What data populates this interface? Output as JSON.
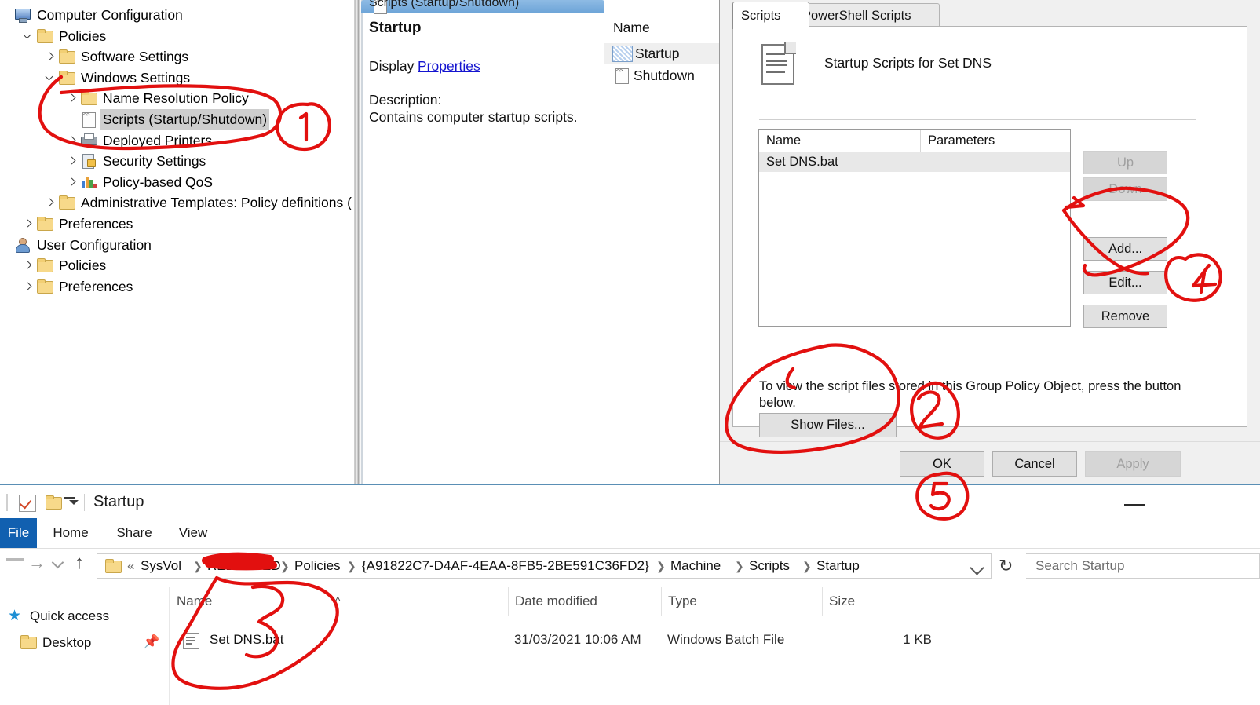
{
  "gpmc": {
    "tree": {
      "nodes": [
        {
          "label": "Computer Configuration",
          "icon": "computer-icon",
          "indent": 0,
          "chevron": "none",
          "selected": false
        },
        {
          "label": "Policies",
          "icon": "folder-icon",
          "indent": 1,
          "chevron": "down",
          "selected": false
        },
        {
          "label": "Software Settings",
          "icon": "folder-icon",
          "indent": 2,
          "chevron": "right",
          "selected": false
        },
        {
          "label": "Windows Settings",
          "icon": "folder-icon",
          "indent": 2,
          "chevron": "down",
          "selected": false
        },
        {
          "label": "Name Resolution Policy",
          "icon": "folder-icon",
          "indent": 3,
          "chevron": "right",
          "selected": false
        },
        {
          "label": "Scripts (Startup/Shutdown)",
          "icon": "script-icon",
          "indent": 3,
          "chevron": "none",
          "selected": true
        },
        {
          "label": "Deployed Printers",
          "icon": "printer-icon",
          "indent": 3,
          "chevron": "right",
          "selected": false
        },
        {
          "label": "Security Settings",
          "icon": "security-icon",
          "indent": 3,
          "chevron": "right",
          "selected": false
        },
        {
          "label": "Policy-based QoS",
          "icon": "qos-icon",
          "indent": 3,
          "chevron": "right",
          "selected": false
        },
        {
          "label": "Administrative Templates: Policy definitions (AD",
          "icon": "folder-icon",
          "indent": 2,
          "chevron": "right",
          "selected": false
        },
        {
          "label": "Preferences",
          "icon": "folder-icon",
          "indent": 1,
          "chevron": "right",
          "selected": false
        },
        {
          "label": "User Configuration",
          "icon": "user-icon",
          "indent": 0,
          "chevron": "none",
          "selected": false
        },
        {
          "label": "Policies",
          "icon": "folder-icon",
          "indent": 1,
          "chevron": "right",
          "selected": false
        },
        {
          "label": "Preferences",
          "icon": "folder-icon",
          "indent": 1,
          "chevron": "right",
          "selected": false
        }
      ]
    },
    "middle": {
      "tab_label": "Scripts (Startup/Shutdown)",
      "heading": "Startup",
      "display_label": "Display",
      "properties_link": "Properties",
      "description_label": "Description:",
      "description_text": "Contains computer startup scripts.",
      "name_column": "Name",
      "items": [
        {
          "label": "Startup",
          "selected": true
        },
        {
          "label": "Shutdown",
          "selected": false
        }
      ]
    }
  },
  "dialog": {
    "tabs": [
      {
        "label": "Scripts",
        "active": true
      },
      {
        "label": "PowerShell Scripts",
        "active": false
      }
    ],
    "header_title": "Startup Scripts for Set DNS",
    "list": {
      "columns": [
        "Name",
        "Parameters"
      ],
      "rows": [
        {
          "name": "Set DNS.bat",
          "parameters": ""
        }
      ]
    },
    "side_buttons": [
      {
        "label": "Up",
        "disabled": true
      },
      {
        "label": "Down",
        "disabled": true
      },
      {
        "label": "Add...",
        "disabled": false
      },
      {
        "label": "Edit...",
        "disabled": false
      },
      {
        "label": "Remove",
        "disabled": false
      }
    ],
    "hint_text": "To view the script files stored in this Group Policy Object, press the button below.",
    "show_files_label": "Show Files...",
    "footer_buttons": [
      {
        "label": "OK",
        "disabled": false
      },
      {
        "label": "Cancel",
        "disabled": false
      },
      {
        "label": "Apply",
        "disabled": true
      }
    ]
  },
  "explorer": {
    "title": "Startup",
    "ribbon_tabs": [
      "File",
      "Home",
      "Share",
      "View"
    ],
    "breadcrumbs": [
      "«",
      "SysVol",
      "REDACTED",
      "Policies",
      "{A91822C7-D4AF-4EAA-8FB5-2BE591C36FD2}",
      "Machine",
      "Scripts",
      "Startup"
    ],
    "search_placeholder": "Search Startup",
    "columns": [
      "Name",
      "Date modified",
      "Type",
      "Size"
    ],
    "nav_items": [
      {
        "label": "Quick access",
        "icon": "star-icon",
        "pinned": false
      },
      {
        "label": "Desktop",
        "icon": "folder-icon",
        "pinned": true
      }
    ],
    "files": [
      {
        "name": "Set DNS.bat",
        "date_modified": "31/03/2021 10:06 AM",
        "type": "Windows Batch File",
        "size": "1 KB",
        "icon": "batch-file-icon"
      }
    ],
    "minimize_label": "—"
  },
  "annotations": {
    "color": "#e2100f",
    "marks": [
      {
        "number": "1",
        "target": "tree Scripts (Startup/Shutdown) node"
      },
      {
        "number": "2",
        "target": "Show Files... button"
      },
      {
        "number": "3",
        "target": "Set DNS.bat file in explorer"
      },
      {
        "number": "4",
        "target": "Add... / Edit... buttons"
      },
      {
        "number": "5",
        "target": "OK button"
      }
    ]
  }
}
